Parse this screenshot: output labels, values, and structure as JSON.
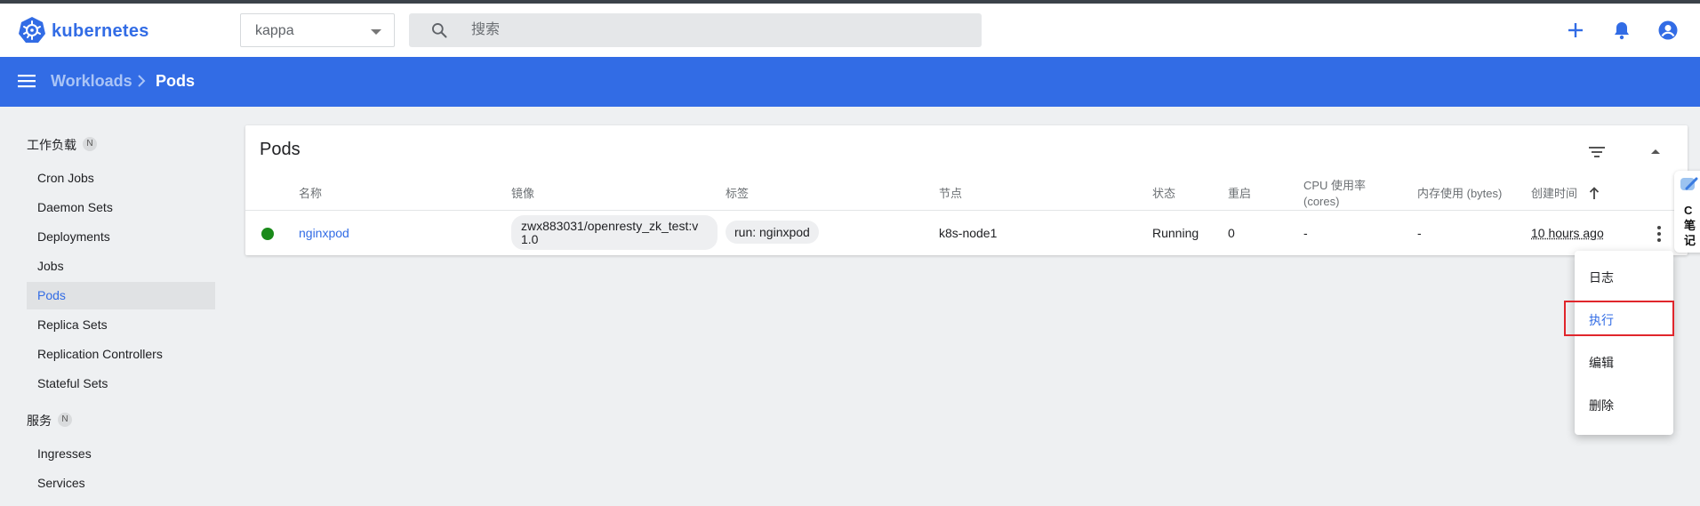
{
  "app": {
    "logo_text": "kubernetes"
  },
  "namespace": {
    "value": "kappa"
  },
  "search": {
    "placeholder": "搜索"
  },
  "breadcrumb": {
    "parent": "Workloads",
    "current": "Pods"
  },
  "sidebar": {
    "sections": [
      {
        "title": "工作负载",
        "badge": "N"
      },
      {
        "title": "服务",
        "badge": "N"
      }
    ],
    "items": [
      {
        "label": "Cron Jobs",
        "active": false
      },
      {
        "label": "Daemon Sets",
        "active": false
      },
      {
        "label": "Deployments",
        "active": false
      },
      {
        "label": "Jobs",
        "active": false
      },
      {
        "label": "Pods",
        "active": true
      },
      {
        "label": "Replica Sets",
        "active": false
      },
      {
        "label": "Replication Controllers",
        "active": false
      },
      {
        "label": "Stateful Sets",
        "active": false
      },
      {
        "label": "Ingresses",
        "active": false
      },
      {
        "label": "Services",
        "active": false
      }
    ]
  },
  "card": {
    "title": "Pods",
    "columns": {
      "name": "名称",
      "image": "镜像",
      "labels": "标签",
      "node": "节点",
      "status": "状态",
      "restarts": "重启",
      "cpu_line1": "CPU 使用率",
      "cpu_line2": "(cores)",
      "memory": "内存使用 (bytes)",
      "created": "创建时间"
    },
    "rows": [
      {
        "status_color": "#1a8a1a",
        "name": "nginxpod",
        "image": "zwx883031/openresty_zk_test:v1.0",
        "label": "run: nginxpod",
        "node": "k8s-node1",
        "status": "Running",
        "restarts": "0",
        "cpu": "-",
        "memory": "-",
        "created": "10 hours ago"
      }
    ]
  },
  "context_menu": {
    "items": [
      "日志",
      "执行",
      "编辑",
      "删除"
    ],
    "highlighted": "执行"
  },
  "side_widget": {
    "text": "C 笔 记"
  },
  "colors": {
    "brand": "#326ce5",
    "running": "#1a8a1a",
    "highlight_outline": "#e0262c"
  }
}
